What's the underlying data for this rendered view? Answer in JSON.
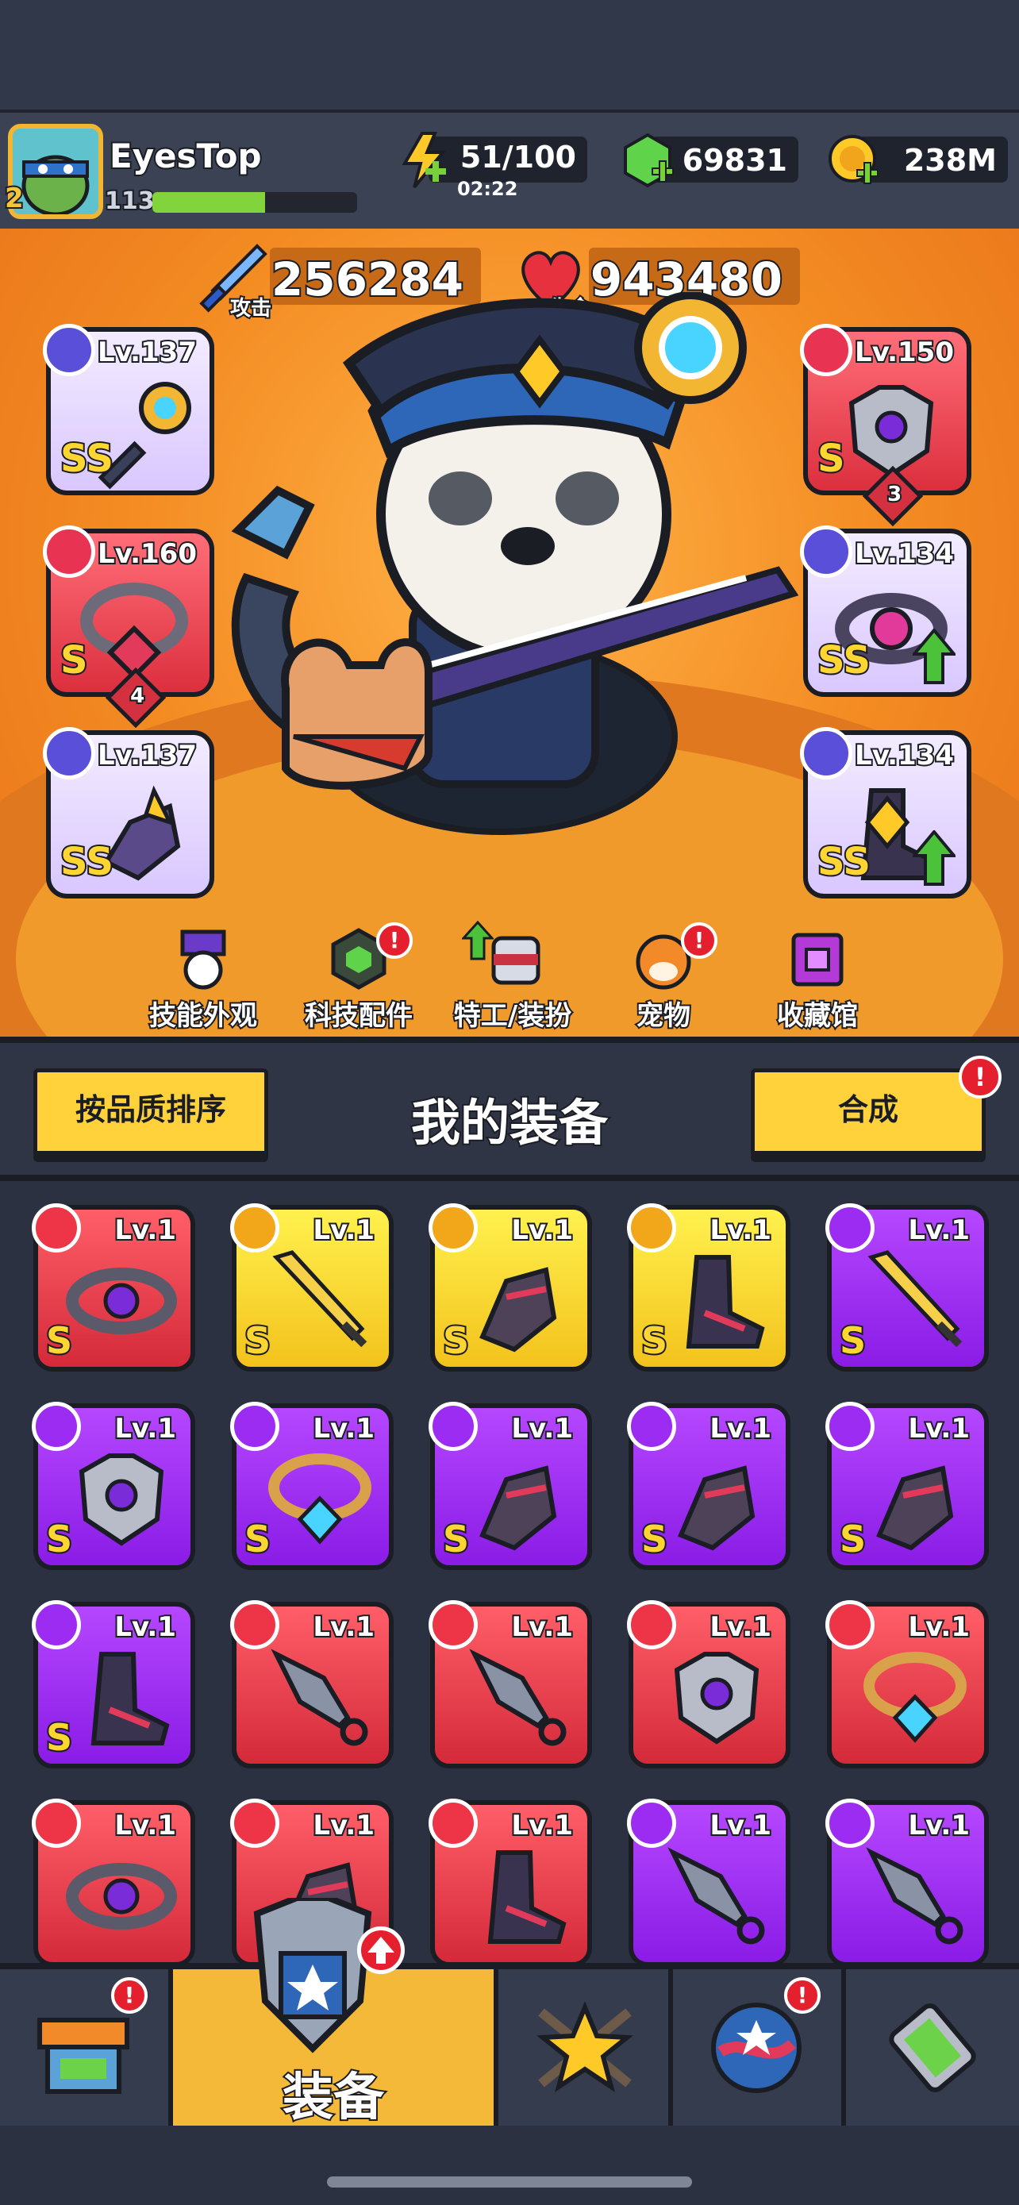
{
  "player": {
    "name": "EyesTop",
    "level": "113",
    "vip": "2",
    "xp_fraction": 0.55
  },
  "resources": {
    "energy": "51/100",
    "energy_timer": "02:22",
    "gems": "69831",
    "gold": "238M"
  },
  "stats": {
    "attack_label": "攻击",
    "attack_value": "256284",
    "hp_label": "生命",
    "hp_value": "943480"
  },
  "equipped": [
    {
      "slot": "weapon",
      "level": "Lv.137",
      "grade": "SS",
      "rarity": "purple"
    },
    {
      "slot": "necklace",
      "level": "Lv.160",
      "grade": "S",
      "rarity": "red",
      "stars": "4"
    },
    {
      "slot": "gloves",
      "level": "Lv.137",
      "grade": "SS",
      "rarity": "purple"
    },
    {
      "slot": "armor",
      "level": "Lv.150",
      "grade": "S",
      "rarity": "red",
      "stars": "3"
    },
    {
      "slot": "belt",
      "level": "Lv.134",
      "grade": "SS",
      "rarity": "purple",
      "upgrade": true
    },
    {
      "slot": "boots",
      "level": "Lv.134",
      "grade": "SS",
      "rarity": "purple",
      "upgrade": true
    }
  ],
  "hero_menu": [
    {
      "label": "技能外观",
      "icon": "skill-skin-icon",
      "alert": false
    },
    {
      "label": "科技配件",
      "icon": "tech-parts-icon",
      "alert": true
    },
    {
      "label": "特工/装扮",
      "icon": "agent-costume-icon",
      "alert": false,
      "up": true
    },
    {
      "label": "宠物",
      "icon": "pet-icon",
      "alert": true
    },
    {
      "label": "收藏馆",
      "icon": "collection-icon",
      "alert": false
    }
  ],
  "equip_header": {
    "sort_label": "按品质排序",
    "title": "我的装备",
    "merge_label": "合成"
  },
  "inventory": [
    {
      "level": "Lv.1",
      "rarity": "red",
      "grade": "S",
      "kind": "belt"
    },
    {
      "level": "Lv.1",
      "rarity": "yellow",
      "grade": "S",
      "kind": "sword"
    },
    {
      "level": "Lv.1",
      "rarity": "yellow",
      "grade": "S",
      "kind": "gloves"
    },
    {
      "level": "Lv.1",
      "rarity": "yellow",
      "grade": "S",
      "kind": "boots"
    },
    {
      "level": "Lv.1",
      "rarity": "purple",
      "grade": "S",
      "kind": "sword"
    },
    {
      "level": "Lv.1",
      "rarity": "purple",
      "grade": "S",
      "kind": "armor"
    },
    {
      "level": "Lv.1",
      "rarity": "purple",
      "grade": "S",
      "kind": "necklace"
    },
    {
      "level": "Lv.1",
      "rarity": "purple",
      "grade": "S",
      "kind": "gloves"
    },
    {
      "level": "Lv.1",
      "rarity": "purple",
      "grade": "S",
      "kind": "gloves"
    },
    {
      "level": "Lv.1",
      "rarity": "purple",
      "grade": "S",
      "kind": "gloves"
    },
    {
      "level": "Lv.1",
      "rarity": "purple",
      "grade": "S",
      "kind": "boots"
    },
    {
      "level": "Lv.1",
      "rarity": "red",
      "grade": "",
      "kind": "kunai"
    },
    {
      "level": "Lv.1",
      "rarity": "red",
      "grade": "",
      "kind": "kunai"
    },
    {
      "level": "Lv.1",
      "rarity": "red",
      "grade": "",
      "kind": "armor"
    },
    {
      "level": "Lv.1",
      "rarity": "red",
      "grade": "",
      "kind": "necklace"
    },
    {
      "level": "Lv.1",
      "rarity": "red",
      "grade": "",
      "kind": "belt"
    },
    {
      "level": "Lv.1",
      "rarity": "red",
      "grade": "",
      "kind": "gloves"
    },
    {
      "level": "Lv.1",
      "rarity": "red",
      "grade": "",
      "kind": "boots"
    },
    {
      "level": "Lv.1",
      "rarity": "purple",
      "grade": "",
      "kind": "kunai"
    },
    {
      "level": "Lv.1",
      "rarity": "purple",
      "grade": "",
      "kind": "kunai"
    }
  ],
  "bottom_nav": {
    "shop_icon": "shop-icon",
    "equip_label": "装备",
    "battle_icon": "battle-star-icon",
    "world_icon": "world-icon",
    "evolve_icon": "dna-icon"
  },
  "colors": {
    "hero_bg": "#f38b22",
    "button_yellow": "#ffd23c",
    "rarity_red": "#d42a3a",
    "rarity_purple": "#8a1ce6",
    "rarity_yellow": "#f3c21c",
    "alert_red": "#e5202e"
  }
}
